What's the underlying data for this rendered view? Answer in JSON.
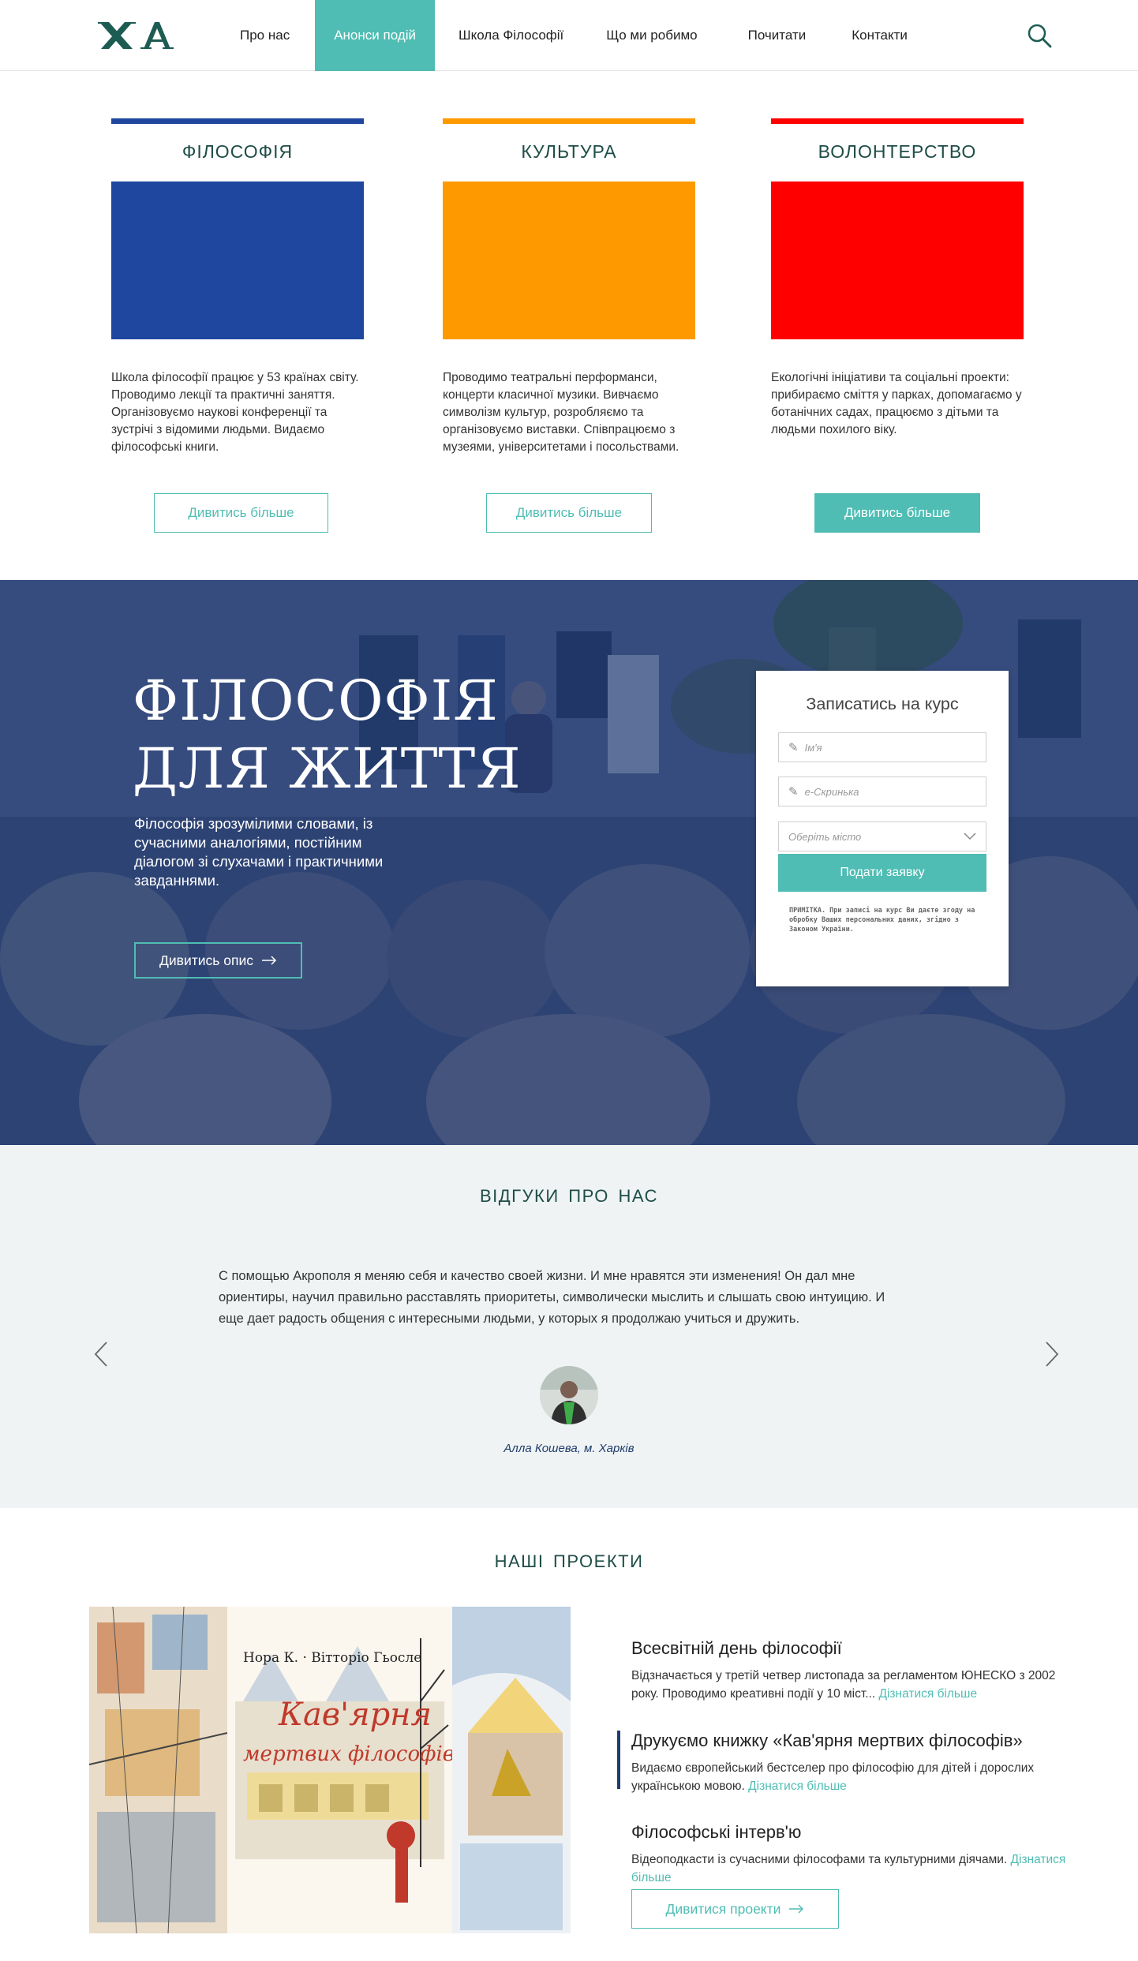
{
  "header": {
    "nav": [
      "Про нас",
      "Анонси подій",
      "Школа Філософії",
      "Що ми робимо",
      "Почитати",
      "Контакти"
    ],
    "active_index": 1
  },
  "categories": [
    {
      "title": "ФІЛОСОФІЯ",
      "color": "#1f47a0",
      "description": "Школа філософії працює у 53 країнах світу. Проводимо лекції та практичні заняття. Організовуємо наукові конференції та зустрічі з відомими людьми. Видаємо філософські книги.",
      "button": "Дивитись більше"
    },
    {
      "title": "КУЛЬТУРА",
      "color": "#fe9a00",
      "description": "Проводимо театральні перформанси, концерти класичної музики. Вивчаємо символізм культур, розробляємо та організовуємо виставки. Співпрацюємо з музеями, університетами і посольствами.",
      "button": "Дивитись більше"
    },
    {
      "title": "ВОЛОНТЕРСТВО",
      "color": "#ff0000",
      "description": "Екологічні ініціативи та соціальні проекти: прибираємо сміття у парках, допомагаємо у ботанічних садах, працюємо з дітьми та людьми похилого віку.",
      "button": "Дивитись більше"
    }
  ],
  "hero": {
    "title_line1": "ФІЛОСОФІЯ",
    "title_line2": "ДЛЯ ЖИТТЯ",
    "subtitle": "Філософія зрозумілими словами, із сучасними аналогіями, постійним діалогом зі слухачами і практичними завданнями.",
    "button": "Дивитись опис"
  },
  "signup_form": {
    "title": "Записатись на курс",
    "name_placeholder": "Ім'я",
    "email_placeholder": "е-Скринька",
    "city_placeholder": "Оберіть місто",
    "submit": "Подати заявку",
    "note": "ПРИМІТКА. При записі на курс Ви даєте згоду на обробку Ваших персональних даних, згідно з Законом України."
  },
  "reviews": {
    "heading": "ВІДГУКИ ПРО НАС",
    "quote": "С помощью Акрополя я меняю себя и качество своей жизни. И мне нравятся эти изменения! Он дал мне ориентиры, научил правильно расставлять приоритеты, символически мыслить и слышать свою интуицию. И еще дает радость общения с интересными людьми, у которых я продолжаю учиться и дружить.",
    "author": "Алла Кошева, м. Харків"
  },
  "projects": {
    "heading": "НАШІ ПРОЕКТИ",
    "items": [
      {
        "title": "Всесвітній день філософії",
        "description": "Відзначається у третій четвер листопада за регламентом ЮНЕСКО з 2002 року. Проводимо креативні події у 10 міст...",
        "link": "Дізнатися більше"
      },
      {
        "title": "Друкуємо книжку «Кав'ярня мертвих філософів»",
        "description": "Видаємо європейський бестселер про філософію для дітей і дорослих українською мовою.",
        "link": "Дізнатися більше"
      },
      {
        "title": "Філософські інтерв'ю",
        "description": "Відеоподкасти із сучасними філософами та культурними діячами.",
        "link": "Дізнатися більше"
      }
    ],
    "button": "Дивитися проекти",
    "book": {
      "authors": "Нора К. · Вітторіо Гьосле",
      "title_line1": "Кав'ярня",
      "title_line2": "мертвих філософів"
    }
  },
  "colors": {
    "accent": "#4fbdb3",
    "heading": "#1e4d47",
    "hero_overlay": "#2a3f6d"
  }
}
